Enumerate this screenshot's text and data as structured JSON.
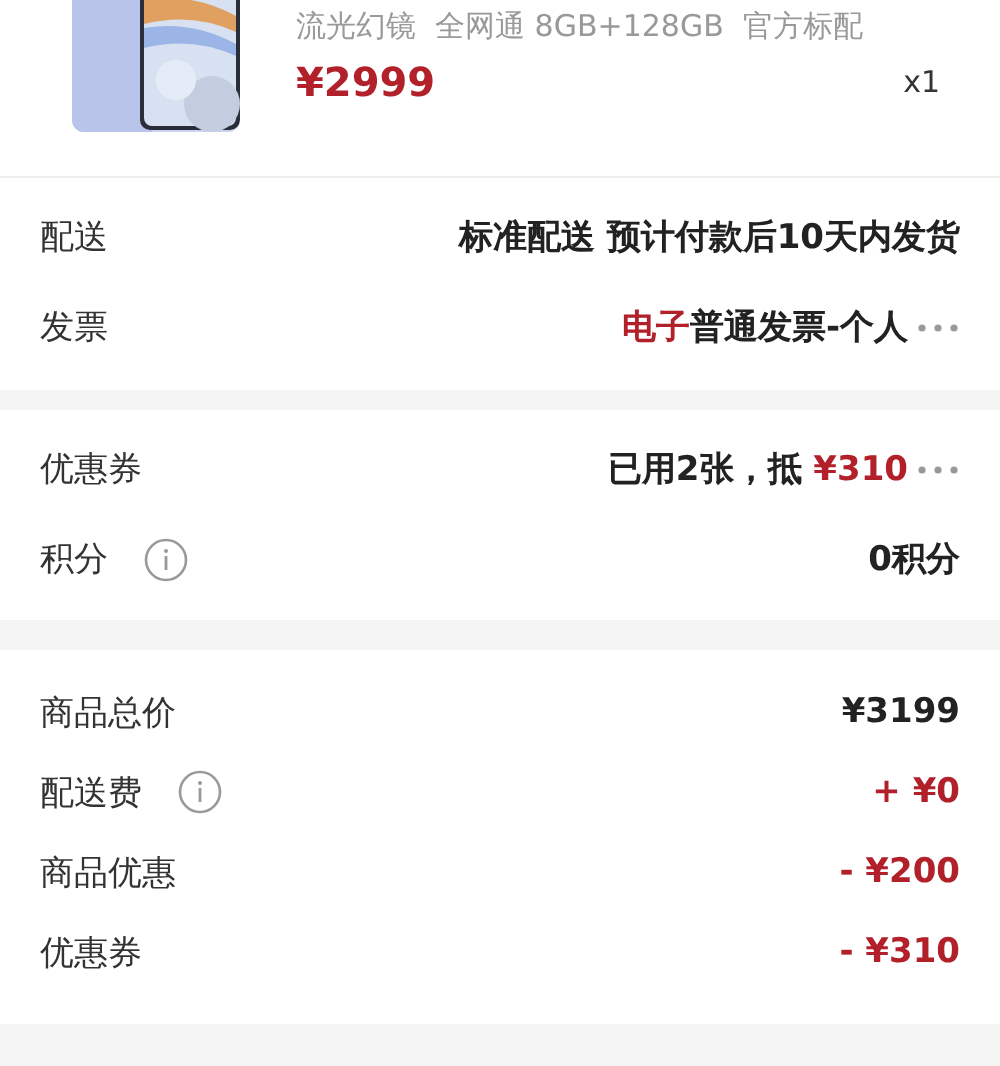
{
  "product": {
    "spec": "流光幻镜  全网通 8GB+128GB  官方标配",
    "price": "¥2999",
    "quantity": "x1"
  },
  "sections": [
    {
      "rows": [
        {
          "label": "配送",
          "info": false,
          "more": false,
          "value": [
            {
              "text": "标准配送 预计付款后10天内发货",
              "accent": false
            }
          ]
        },
        {
          "label": "发票",
          "info": false,
          "more": true,
          "value": [
            {
              "text": "电子",
              "accent": true
            },
            {
              "text": "普通发票-个人",
              "accent": false
            }
          ]
        }
      ]
    },
    {
      "rows": [
        {
          "label": "优惠券",
          "info": false,
          "more": true,
          "value": [
            {
              "text": "已用2张，抵 ",
              "accent": false
            },
            {
              "text": "¥310",
              "accent": true
            }
          ]
        },
        {
          "label": "积分",
          "info": true,
          "more": false,
          "value": [
            {
              "text": "0积分",
              "accent": false
            }
          ]
        }
      ]
    }
  ],
  "summary": [
    {
      "label": "商品总价",
      "info": false,
      "amount": "¥3199",
      "accent": false
    },
    {
      "label": "配送费",
      "info": true,
      "amount": "+ ¥0",
      "accent": true
    },
    {
      "label": "商品优惠",
      "info": false,
      "amount": "- ¥200",
      "accent": true
    },
    {
      "label": "优惠券",
      "info": false,
      "amount": "- ¥310",
      "accent": true
    }
  ]
}
